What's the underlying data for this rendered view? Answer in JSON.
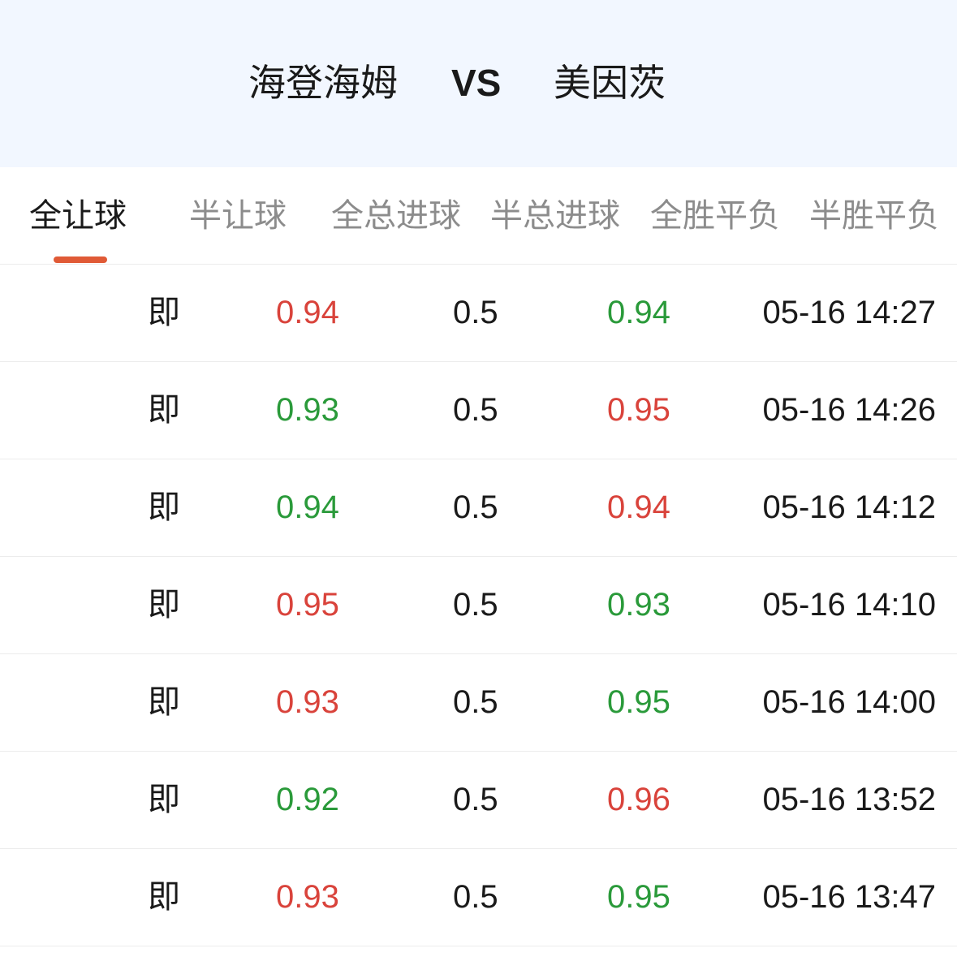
{
  "header": {
    "home_team": "海登海姆",
    "vs": "VS",
    "away_team": "美因茨"
  },
  "tabs": [
    {
      "label": "全让球",
      "active": true
    },
    {
      "label": "半让球",
      "active": false
    },
    {
      "label": "全总进球",
      "active": false
    },
    {
      "label": "半总进球",
      "active": false
    },
    {
      "label": "全胜平负",
      "active": false
    },
    {
      "label": "半胜平负",
      "active": false
    }
  ],
  "colors": {
    "accent": "#e05a36",
    "up": "#d9433b",
    "down": "#2a9a3a",
    "header_bg": "#f2f7ff"
  },
  "rows": [
    {
      "type": "即",
      "home": "0.94",
      "home_trend": "up",
      "line": "0.5",
      "away": "0.94",
      "away_trend": "down",
      "time": "05-16 14:27"
    },
    {
      "type": "即",
      "home": "0.93",
      "home_trend": "down",
      "line": "0.5",
      "away": "0.95",
      "away_trend": "up",
      "time": "05-16 14:26"
    },
    {
      "type": "即",
      "home": "0.94",
      "home_trend": "down",
      "line": "0.5",
      "away": "0.94",
      "away_trend": "up",
      "time": "05-16 14:12"
    },
    {
      "type": "即",
      "home": "0.95",
      "home_trend": "up",
      "line": "0.5",
      "away": "0.93",
      "away_trend": "down",
      "time": "05-16 14:10"
    },
    {
      "type": "即",
      "home": "0.93",
      "home_trend": "up",
      "line": "0.5",
      "away": "0.95",
      "away_trend": "down",
      "time": "05-16 14:00"
    },
    {
      "type": "即",
      "home": "0.92",
      "home_trend": "down",
      "line": "0.5",
      "away": "0.96",
      "away_trend": "up",
      "time": "05-16 13:52"
    },
    {
      "type": "即",
      "home": "0.93",
      "home_trend": "up",
      "line": "0.5",
      "away": "0.95",
      "away_trend": "down",
      "time": "05-16 13:47"
    }
  ]
}
